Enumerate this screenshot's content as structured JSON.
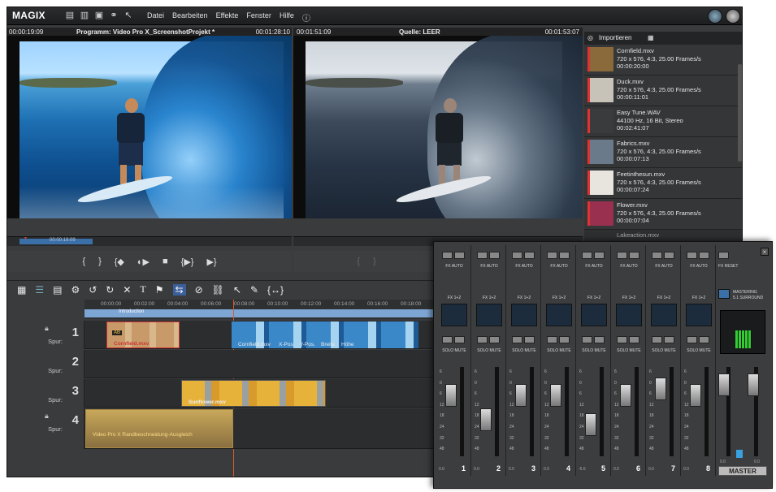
{
  "menubar": {
    "logo": "MAGIX",
    "items": [
      "Datei",
      "Bearbeiten",
      "Effekte",
      "Fenster",
      "Hilfe"
    ]
  },
  "program_monitor": {
    "time_left": "00:00:19:09",
    "title": "Programm: Video Pro X_ScreenshotProjekt *",
    "time_right": "00:01:28:10",
    "scrub_time": "00:00:19:09"
  },
  "source_monitor": {
    "time_left": "00:01:51:09",
    "title": "Quelle: LEER",
    "time_right": "00:01:53:07"
  },
  "transport": {
    "buttons": [
      "{",
      "}",
      "{◆",
      "◐▶",
      "■",
      "{▶}",
      "▶}"
    ]
  },
  "media_pool": {
    "title": "Importieren",
    "items": [
      {
        "name": "Cornfield.mxv",
        "line2": "720 x 576, 4:3, 25.00 Frames/s",
        "line3": "00:00:20:00",
        "color": "#8a6a3a"
      },
      {
        "name": "Duck.mxv",
        "line2": "720 x 576, 4:3, 25.00 Frames/s",
        "line3": "00:00:11:01",
        "color": "#c7c3b8"
      },
      {
        "name": "Easy Tune.WAV",
        "line2": "44100 Hz, 16 Bit, Stereo",
        "line3": "00:02:41:07",
        "color": "#3a3b3d"
      },
      {
        "name": "Fabrics.mxv",
        "line2": "720 x 576, 4:3, 25.00 Frames/s",
        "line3": "00:00:07:13",
        "color": "#6a7a8a"
      },
      {
        "name": "Feetinthesun.mxv",
        "line2": "720 x 576, 4:3, 25.00 Frames/s",
        "line3": "00:00:07:24",
        "color": "#e8e4de"
      },
      {
        "name": "Flower.mxv",
        "line2": "720 x 576, 4:3, 25.00 Frames/s",
        "line3": "00:00:07:04",
        "color": "#9a3050"
      }
    ],
    "partial": "Lakeaction.mxv"
  },
  "timeline": {
    "ruler": [
      "00:00:00",
      "00:02:00",
      "00:04:00",
      "00:06:00",
      "00:08:00",
      "00:10:00",
      "00:12:00",
      "00:14:00",
      "00:16:00",
      "00:18:00",
      "00:20:00"
    ],
    "marker": "Introduction",
    "tracks": [
      {
        "num": "1",
        "label": "Spur:"
      },
      {
        "num": "2",
        "label": "Spur:"
      },
      {
        "num": "3",
        "label": "Spur:"
      },
      {
        "num": "4",
        "label": "Spur:"
      }
    ],
    "clips": {
      "cornfield": "Cornfield.mxv",
      "cornfield2": "Cornfield.mxv",
      "xpos": "X-Pos.",
      "ypos": "Y-Pos.",
      "breite": "Breite",
      "hoehe": "Höhe",
      "sunflower": "Sunflower.mxv",
      "track4": "Video Pro X    Randbeschneidung-Ausgleich"
    }
  },
  "mixer": {
    "fx_label": "FX  AUTO",
    "fx_reset": "FX  RESET",
    "solo_mute": "SOLO  MUTE",
    "fx12": "FX 1+2",
    "scale": [
      "6",
      "0",
      "6",
      "12",
      "18",
      "24",
      "32",
      "48"
    ],
    "channels": [
      {
        "num": "1",
        "val": "0.0",
        "level": 0.74
      },
      {
        "num": "2",
        "val": "0.0",
        "level": 0.38
      },
      {
        "num": "3",
        "val": "0.0",
        "level": 0.74
      },
      {
        "num": "4",
        "val": "0.0",
        "level": 0.74
      },
      {
        "num": "5",
        "val": "-6.6",
        "level": 0.3
      },
      {
        "num": "6",
        "val": "0.0",
        "level": 0.74
      },
      {
        "num": "7",
        "val": "0.0",
        "level": 0.84
      },
      {
        "num": "8",
        "val": "0.0",
        "level": 0.74
      }
    ],
    "mastering": "MASTERING",
    "surround": "5.1 SURROUND",
    "master_label": "MASTER",
    "master_vals": [
      "0.0",
      "0.0"
    ]
  }
}
